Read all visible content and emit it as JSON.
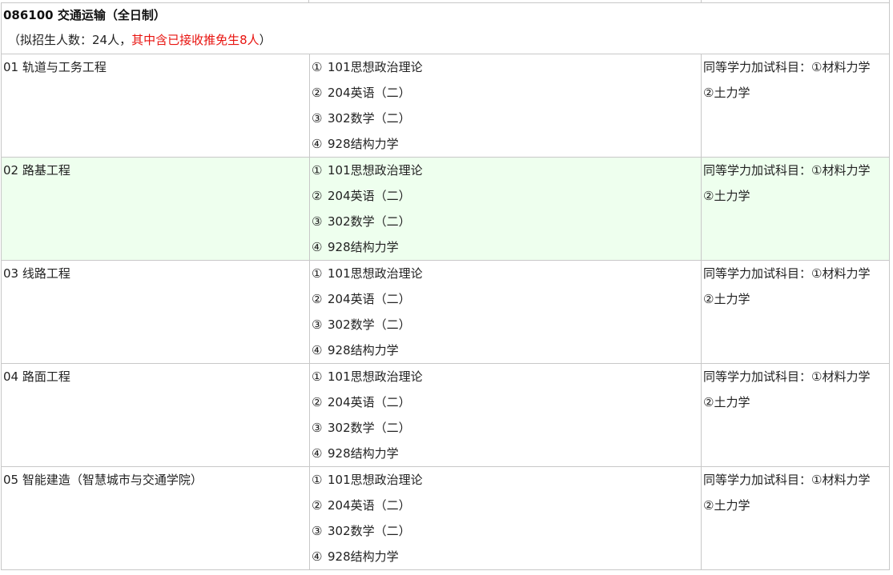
{
  "program": {
    "title": "086100 交通运输（全日制）",
    "quota_prefix": "（拟招生人数：24人，",
    "quota_highlight": "其中含已接收推免生8人",
    "quota_suffix": "）",
    "highlight_color": "#e8130f",
    "alt_row_color": "#eeffee"
  },
  "directions": [
    {
      "name": "01 轨道与工务工程",
      "exams": [
        {
          "num": "①",
          "text": "101思想政治理论"
        },
        {
          "num": "②",
          "text": "204英语（二）"
        },
        {
          "num": "③",
          "text": "302数学（二）"
        },
        {
          "num": "④",
          "text": "928结构力学"
        }
      ],
      "notes": [
        "同等学力加试科目：①材料力学",
        "②土力学"
      ]
    },
    {
      "name": "02 路基工程",
      "exams": [
        {
          "num": "①",
          "text": "101思想政治理论"
        },
        {
          "num": "②",
          "text": "204英语（二）"
        },
        {
          "num": "③",
          "text": "302数学（二）"
        },
        {
          "num": "④",
          "text": "928结构力学"
        }
      ],
      "notes": [
        "同等学力加试科目：①材料力学",
        "②土力学"
      ]
    },
    {
      "name": "03 线路工程",
      "exams": [
        {
          "num": "①",
          "text": "101思想政治理论"
        },
        {
          "num": "②",
          "text": "204英语（二）"
        },
        {
          "num": "③",
          "text": "302数学（二）"
        },
        {
          "num": "④",
          "text": "928结构力学"
        }
      ],
      "notes": [
        "同等学力加试科目：①材料力学",
        "②土力学"
      ]
    },
    {
      "name": "04 路面工程",
      "exams": [
        {
          "num": "①",
          "text": "101思想政治理论"
        },
        {
          "num": "②",
          "text": "204英语（二）"
        },
        {
          "num": "③",
          "text": "302数学（二）"
        },
        {
          "num": "④",
          "text": "928结构力学"
        }
      ],
      "notes": [
        "同等学力加试科目：①材料力学",
        "②土力学"
      ]
    },
    {
      "name": "05 智能建造（智慧城市与交通学院）",
      "exams": [
        {
          "num": "①",
          "text": "101思想政治理论"
        },
        {
          "num": "②",
          "text": "204英语（二）"
        },
        {
          "num": "③",
          "text": "302数学（二）"
        },
        {
          "num": "④",
          "text": "928结构力学"
        }
      ],
      "notes": [
        "同等学力加试科目：①材料力学",
        "②土力学"
      ]
    }
  ]
}
